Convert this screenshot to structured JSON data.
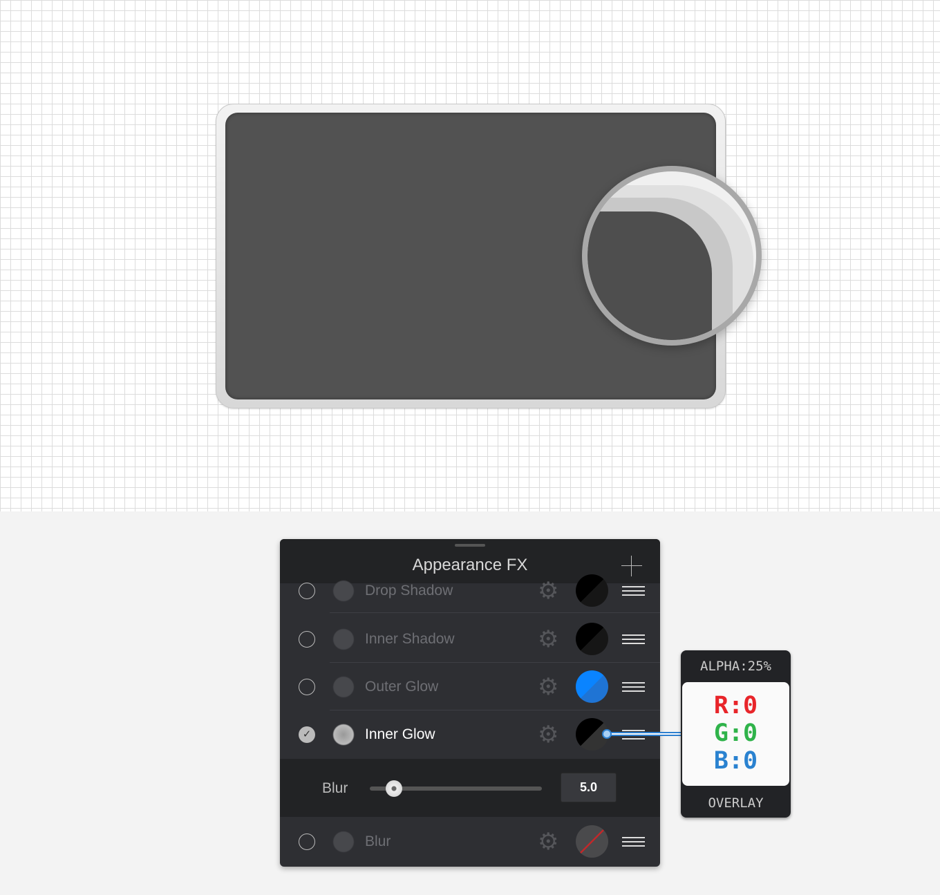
{
  "panel": {
    "title": "Appearance FX",
    "add_icon": "plus-icon",
    "effects": [
      {
        "label": "Drop Shadow",
        "enabled": false,
        "swatch": "#000000"
      },
      {
        "label": "Inner Shadow",
        "enabled": false,
        "swatch": "#000000"
      },
      {
        "label": "Outer Glow",
        "enabled": false,
        "swatch": "#0a84ff"
      },
      {
        "label": "Inner Glow",
        "enabled": true,
        "swatch": "#000000"
      },
      {
        "label": "Blur",
        "enabled": false,
        "swatch": "none"
      }
    ],
    "blur": {
      "label": "Blur",
      "value": "5.0",
      "slider_fraction": 0.14
    }
  },
  "color_popup": {
    "alpha": "ALPHA:25%",
    "r": "R:0",
    "g": "G:0",
    "b": "B:0",
    "blend": "OVERLAY",
    "colors": {
      "r": "#e8252a",
      "g": "#2fb34a",
      "b": "#2a82d0"
    }
  }
}
